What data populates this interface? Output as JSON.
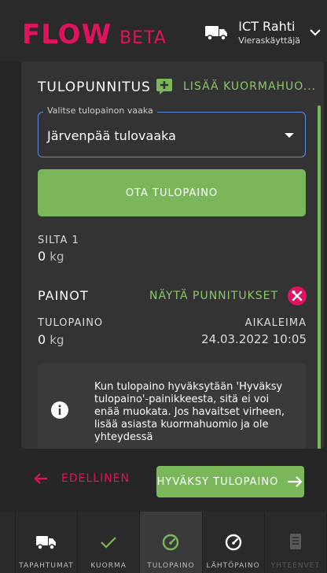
{
  "header": {
    "logo_main": "FLOW",
    "logo_beta": "BETA",
    "user_name": "ICT Rahti",
    "user_role": "Vieraskäyttäjä",
    "brand_color": "#e0135f"
  },
  "card": {
    "section_title": "TULOPUNNITUS",
    "add_comment_label": "LISÄÄ KUORMAHUO...",
    "scale_select": {
      "legend": "Valitse tulopainon vaaka",
      "value": "Järvenpää tulovaaka"
    },
    "take_weight_label": "OTA TULOPAINO",
    "silta": {
      "label": "SILTA 1",
      "value": "0",
      "unit": "kg"
    },
    "weights": {
      "label": "PAINOT",
      "show_label": "NÄYTÄ PUNNITUKSET",
      "tulopaino_label": "TULOPAINO",
      "tulopaino_value": "0",
      "tulopaino_unit": "kg",
      "timestamp_label": "AIKALEIMA",
      "timestamp_value": "24.03.2022 10:05"
    },
    "info_text": "Kun tulopaino hyväksytään 'Hyväksy tulopaino'-painikkeesta, sitä ei voi enää muokata. Jos havaitset virheen, lisää asiasta kuormahuomio ja ole yhteydessä",
    "accent_color": "#7ab75a"
  },
  "footer": {
    "back_label": "EDELLINEN",
    "accept_label": "HYVÄKSY TULOPAINO"
  },
  "bottom_nav": {
    "items": [
      {
        "label": "TAPAHTUMAT",
        "icon": "truck-icon"
      },
      {
        "label": "KUORMA",
        "icon": "check-icon"
      },
      {
        "label": "TULOPAINO",
        "icon": "gauge-icon"
      },
      {
        "label": "LÄHTÖPAINO",
        "icon": "gauge-outline-icon"
      },
      {
        "label": "YHTEENVET",
        "icon": "document-icon"
      }
    ]
  }
}
